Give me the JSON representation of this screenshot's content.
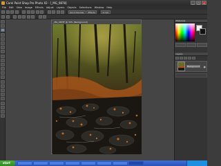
{
  "window": {
    "title": "Corel Paint Shop Pro Photo X2 - [_MG_0878]",
    "controls": [
      "_",
      "□",
      "x"
    ]
  },
  "menu": [
    "File",
    "Edit",
    "View",
    "Image",
    "Effects",
    "Adjust",
    "Layers",
    "Objects",
    "Selections",
    "Window",
    "Help"
  ],
  "toolbar": {
    "left_buttons": 16,
    "buttons_mid": [
      "Quick Review",
      "Effects"
    ],
    "buttons_right": [
      "Script"
    ]
  },
  "document": {
    "title": "_MG_0878* @ 33% (Background)",
    "zoom": "33%"
  },
  "palette": {
    "title": "Materials",
    "fg_color": "#f2f2f2",
    "bg_color": "#111111"
  },
  "layers": {
    "title": "Layers",
    "items": [
      {
        "name": "Background",
        "visible_icon": "eye-icon"
      }
    ]
  },
  "taskbar": {
    "start_label": "start",
    "tasks": [
      "",
      "",
      "",
      "",
      "",
      "",
      "",
      "",
      "",
      "",
      ""
    ],
    "active_task_index": 10,
    "clock": ""
  },
  "colors": {
    "accent": "#3f6fd6",
    "forest_dark": "#2b2614",
    "leaf_orange": "#c26a1e"
  }
}
